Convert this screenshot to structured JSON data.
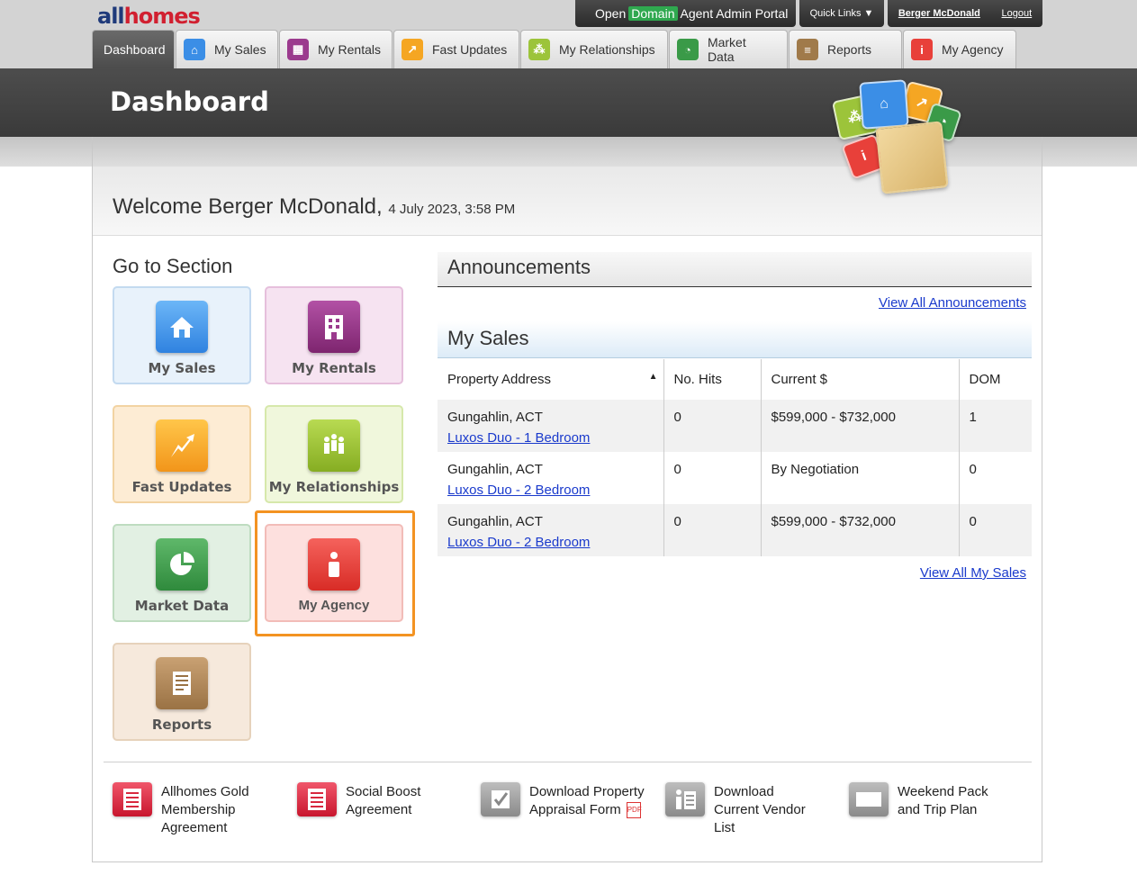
{
  "brand": {
    "logo_left": "all",
    "logo_right": "homes"
  },
  "portal": {
    "open": "Open",
    "domain": "Domain",
    "portal_label": "Agent Admin Portal",
    "quick_links": "Quick Links ▼",
    "user_name": "Berger McDonald",
    "logout": "Logout"
  },
  "tabs": [
    {
      "label": "Dashboard"
    },
    {
      "label": "My Sales",
      "color": "#3b8ee6"
    },
    {
      "label": "My Rentals",
      "color": "#9b3a8e"
    },
    {
      "label": "Fast Updates",
      "color": "#f5a623"
    },
    {
      "label": "My Relationships",
      "color": "#9cc43a"
    },
    {
      "label": "Market Data",
      "color": "#3a9a48"
    },
    {
      "label": "Reports",
      "color": "#a07a4a"
    },
    {
      "label": "My Agency",
      "color": "#e8403a"
    }
  ],
  "page": {
    "title": "Dashboard",
    "welcome": "Welcome Berger McDonald,",
    "date": "4 July 2023, 3:58 PM"
  },
  "go_to_section": {
    "title": "Go to Section",
    "tiles": [
      {
        "label": "My Sales"
      },
      {
        "label": "My Rentals"
      },
      {
        "label": "Fast Updates"
      },
      {
        "label": "My Relationships"
      },
      {
        "label": "Market Data"
      },
      {
        "label": "My Agency"
      },
      {
        "label": "Reports"
      }
    ]
  },
  "announcements": {
    "title": "Announcements",
    "view_all": "View All Announcements"
  },
  "my_sales": {
    "title": "My Sales",
    "columns": [
      "Property Address",
      "No. Hits",
      "Current $",
      "DOM"
    ],
    "sort_indicator": "▲",
    "rows": [
      {
        "suburb": "Gungahlin, ACT",
        "link": "Luxos Duo - 1 Bedroom",
        "hits": "0",
        "price": "$599,000 - $732,000",
        "dom": "1"
      },
      {
        "suburb": "Gungahlin, ACT",
        "link": "Luxos Duo - 2 Bedroom",
        "hits": "0",
        "price": "By Negotiation",
        "dom": "0"
      },
      {
        "suburb": "Gungahlin, ACT",
        "link": "Luxos Duo - 2 Bedroom",
        "hits": "0",
        "price": "$599,000 - $732,000",
        "dom": "0"
      }
    ],
    "view_all": "View All My Sales"
  },
  "downloads": [
    {
      "label": "Allhomes Gold Membership Agreement"
    },
    {
      "label": "Social Boost Agreement"
    },
    {
      "label": "Download Property Appraisal Form"
    },
    {
      "label": "Download Current Vendor List"
    },
    {
      "label": "Weekend Pack and Trip Plan"
    }
  ],
  "misc": {
    "pdf_badge": "PDF"
  }
}
